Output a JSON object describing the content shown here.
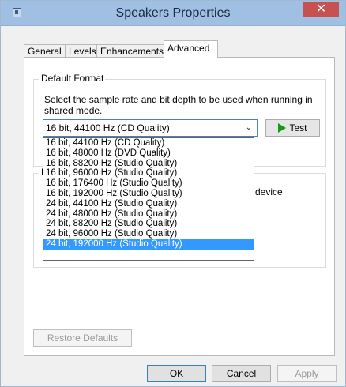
{
  "window": {
    "title": "Speakers Properties",
    "close_glyph": "✕"
  },
  "tabs": [
    {
      "label": "General"
    },
    {
      "label": "Levels"
    },
    {
      "label": "Enhancements"
    },
    {
      "label": "Advanced",
      "active": true
    }
  ],
  "default_format": {
    "group_title": "Default Format",
    "description": "Select the sample rate and bit depth to be used when running in shared mode.",
    "selected_value": "16 bit, 44100 Hz (CD Quality)",
    "test_label": "Test",
    "options": [
      "16 bit, 44100 Hz (CD Quality)",
      "16 bit, 48000 Hz (DVD Quality)",
      "16 bit, 88200 Hz (Studio Quality)",
      "16 bit, 96000 Hz (Studio Quality)",
      "16 bit, 176400 Hz (Studio Quality)",
      "16 bit, 192000 Hz (Studio Quality)",
      "24 bit, 44100 Hz (Studio Quality)",
      "24 bit, 48000 Hz (Studio Quality)",
      "24 bit, 88200 Hz (Studio Quality)",
      "24 bit, 96000 Hz (Studio Quality)",
      "24 bit, 192000 Hz (Studio Quality)"
    ],
    "highlighted_option": "24 bit, 192000 Hz (Studio Quality)"
  },
  "exclusive_mode": {
    "group_title_visible": "E",
    "text_visible": "this device"
  },
  "restore_defaults_label": "Restore Defaults",
  "buttons": {
    "ok": "OK",
    "cancel": "Cancel",
    "apply": "Apply"
  }
}
